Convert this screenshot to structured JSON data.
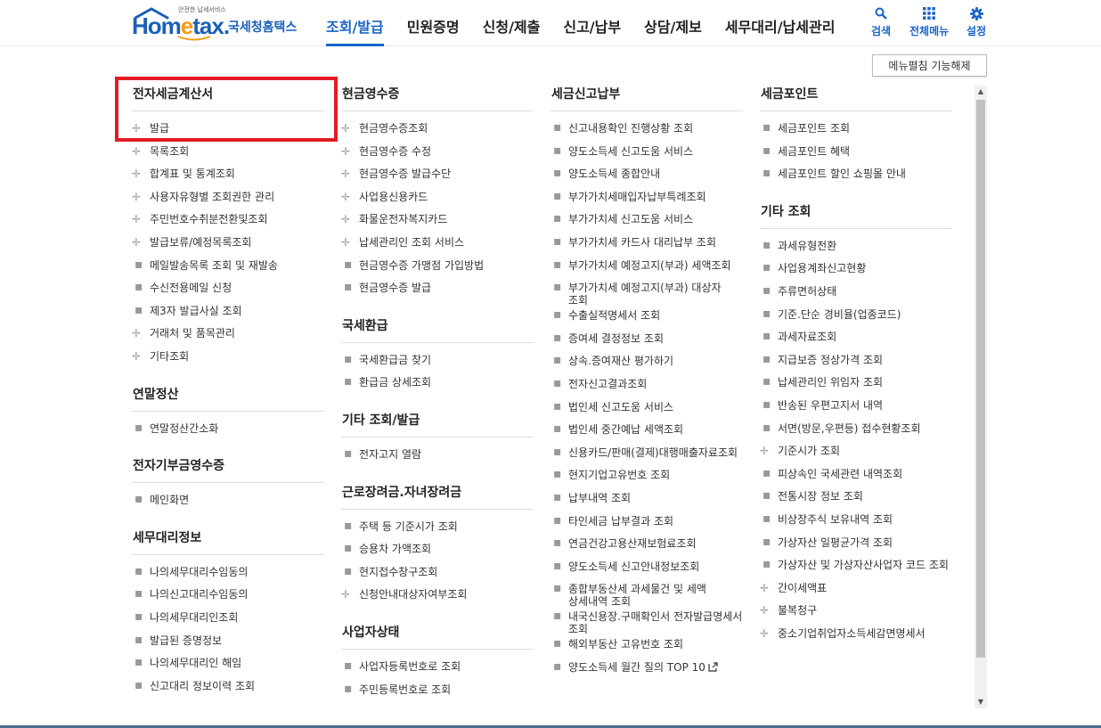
{
  "header": {
    "logo_small": "안전한 납세서비스",
    "logo_brand_a": "Hom",
    "logo_brand_e": "e",
    "logo_brand_b": "tax.",
    "logo_sub": "국세청홈택스",
    "nav": [
      "조회/발급",
      "민원증명",
      "신청/제출",
      "신고/납부",
      "상담/제보",
      "세무대리/납세관리"
    ],
    "active_nav": "조회/발급",
    "util": {
      "search": "검색",
      "all_menu": "전체메뉴",
      "settings": "설정"
    },
    "accent_color": "#1b64c8"
  },
  "collapse_button": "메뉴펼침 기능해제",
  "columns": [
    {
      "sections": [
        {
          "title": "전자세금계산서",
          "items": [
            {
              "label": "발급",
              "mark": "plus"
            },
            {
              "label": "목록조회",
              "mark": "plus"
            },
            {
              "label": "합계표 및 통계조회",
              "mark": "plus"
            },
            {
              "label": "사용자유형별 조회권한 관리",
              "mark": "plus"
            },
            {
              "label": "주민번호수취분전환및조회",
              "mark": "plus"
            },
            {
              "label": "발급보류/예정목록조회",
              "mark": "plus"
            },
            {
              "label": "메일발송목록 조회 및 재발송",
              "mark": "dot"
            },
            {
              "label": "수신전용메일 신청",
              "mark": "dot"
            },
            {
              "label": "제3자 발급사실 조회",
              "mark": "dot"
            },
            {
              "label": "거래처 및 품목관리",
              "mark": "plus"
            },
            {
              "label": "기타조회",
              "mark": "plus"
            }
          ]
        },
        {
          "title": "연말정산",
          "items": [
            {
              "label": "연말정산간소화",
              "mark": "dot"
            }
          ]
        },
        {
          "title": "전자기부금영수증",
          "items": [
            {
              "label": "메인화면",
              "mark": "dot"
            }
          ]
        },
        {
          "title": "세무대리정보",
          "items": [
            {
              "label": "나의세무대리수임동의",
              "mark": "dot"
            },
            {
              "label": "나의신고대리수임동의",
              "mark": "dot"
            },
            {
              "label": "나의세무대리인조회",
              "mark": "dot"
            },
            {
              "label": "발급된 증명정보",
              "mark": "dot"
            },
            {
              "label": "나의세무대리인 해임",
              "mark": "dot"
            },
            {
              "label": "신고대리 정보이력 조회",
              "mark": "dot"
            }
          ]
        }
      ]
    },
    {
      "sections": [
        {
          "title": "현금영수증",
          "items": [
            {
              "label": "현금영수증조회",
              "mark": "plus"
            },
            {
              "label": "현금영수증 수정",
              "mark": "plus"
            },
            {
              "label": "현금영수증 발급수단",
              "mark": "plus"
            },
            {
              "label": "사업용신용카드",
              "mark": "plus"
            },
            {
              "label": "화물운전자복지카드",
              "mark": "plus"
            },
            {
              "label": "납세관리인 조회 서비스",
              "mark": "plus"
            },
            {
              "label": "현금영수증 가맹점 가입방법",
              "mark": "dot"
            },
            {
              "label": "현금영수증 발급",
              "mark": "dot"
            }
          ]
        },
        {
          "title": "국세환급",
          "items": [
            {
              "label": "국세환급금 찾기",
              "mark": "dot"
            },
            {
              "label": "환급금 상세조회",
              "mark": "dot"
            }
          ]
        },
        {
          "title": "기타 조회/발급",
          "items": [
            {
              "label": "전자고지 열람",
              "mark": "dot"
            }
          ]
        },
        {
          "title": "근로장려금.자녀장려금",
          "items": [
            {
              "label": "주택 등 기준시가 조회",
              "mark": "dot"
            },
            {
              "label": "승용차 가액조회",
              "mark": "dot"
            },
            {
              "label": "현지접수창구조회",
              "mark": "dot"
            },
            {
              "label": "신청안내대상자여부조회",
              "mark": "plus"
            }
          ]
        },
        {
          "title": "사업자상태",
          "items": [
            {
              "label": "사업자등록번호로 조회",
              "mark": "dot"
            },
            {
              "label": "주민등록번호로 조회",
              "mark": "dot"
            }
          ]
        }
      ]
    },
    {
      "sections": [
        {
          "title": "세금신고납부",
          "items": [
            {
              "label": "신고내용확인 진행상황 조회",
              "mark": "dot"
            },
            {
              "label": "양도소득세 신고도움 서비스",
              "mark": "dot"
            },
            {
              "label": "양도소득세 종합안내",
              "mark": "dot"
            },
            {
              "label": "부가가치세매입자납부특례조회",
              "mark": "dot"
            },
            {
              "label": "부가가치세 신고도움 서비스",
              "mark": "dot"
            },
            {
              "label": "부가가치세 카드사 대리납부 조회",
              "mark": "dot"
            },
            {
              "label": "부가가치세 예정고지(부과) 세액조회",
              "mark": "dot"
            },
            {
              "label": "부가가치세 예정고지(부과) 대상자 조회",
              "mark": "dot"
            },
            {
              "label": "수출실적명세서 조회",
              "mark": "dot"
            },
            {
              "label": "증여세 결정정보 조회",
              "mark": "dot"
            },
            {
              "label": "상속.증여재산 평가하기",
              "mark": "dot"
            },
            {
              "label": "전자신고결과조회",
              "mark": "dot"
            },
            {
              "label": "법인세 신고도움 서비스",
              "mark": "dot"
            },
            {
              "label": "법인세 중간예납 세액조회",
              "mark": "dot"
            },
            {
              "label": "신용카드/판매(결제)대행매출자료조회",
              "mark": "dot"
            },
            {
              "label": "현지기업고유번호 조회",
              "mark": "dot"
            },
            {
              "label": "납부내역 조회",
              "mark": "dot"
            },
            {
              "label": "타인세금 납부결과 조회",
              "mark": "dot"
            },
            {
              "label": "연금건강고용산재보험료조회",
              "mark": "dot"
            },
            {
              "label": "양도소득세 신고안내정보조회",
              "mark": "dot"
            },
            {
              "label": "종합부동산세 과세물건 및 세액 상세내역 조회",
              "mark": "dot"
            },
            {
              "label": "내국신용장.구매확인서 전자발급명세서 조회",
              "mark": "dot"
            },
            {
              "label": "해외부동산 고유번호 조회",
              "mark": "dot"
            },
            {
              "label": "양도소득세 월간 질의 TOP 10",
              "mark": "dot",
              "external": true
            }
          ]
        }
      ]
    },
    {
      "sections": [
        {
          "title": "세금포인트",
          "items": [
            {
              "label": "세금포인트 조회",
              "mark": "dot"
            },
            {
              "label": "세금포인트 혜택",
              "mark": "dot"
            },
            {
              "label": "세금포인트 할인 쇼핑몰 안내",
              "mark": "dot"
            }
          ]
        },
        {
          "title": "기타 조회",
          "items": [
            {
              "label": "과세유형전환",
              "mark": "dot"
            },
            {
              "label": "사업용계좌신고현황",
              "mark": "dot"
            },
            {
              "label": "주류면허상태",
              "mark": "dot"
            },
            {
              "label": "기준.단순 경비율(업종코드)",
              "mark": "dot"
            },
            {
              "label": "과세자료조회",
              "mark": "dot"
            },
            {
              "label": "지급보증 정상가격 조회",
              "mark": "dot"
            },
            {
              "label": "납세관리인 위임자 조회",
              "mark": "dot"
            },
            {
              "label": "반송된 우편고지서 내역",
              "mark": "dot"
            },
            {
              "label": "서면(방문,우편등) 접수현황조회",
              "mark": "dot"
            },
            {
              "label": "기준시가 조회",
              "mark": "plus"
            },
            {
              "label": "피상속인 국세관련 내역조회",
              "mark": "dot"
            },
            {
              "label": "전통시장 정보 조회",
              "mark": "dot"
            },
            {
              "label": "비상장주식 보유내역 조회",
              "mark": "dot"
            },
            {
              "label": "가상자산 일평균가격 조회",
              "mark": "dot"
            },
            {
              "label": "가상자산 및 가상자산사업자 코드 조회",
              "mark": "dot"
            },
            {
              "label": "간이세액표",
              "mark": "plus"
            },
            {
              "label": "불복청구",
              "mark": "plus"
            },
            {
              "label": "중소기업취업자소득세감면명세서",
              "mark": "plus"
            }
          ]
        }
      ]
    }
  ]
}
